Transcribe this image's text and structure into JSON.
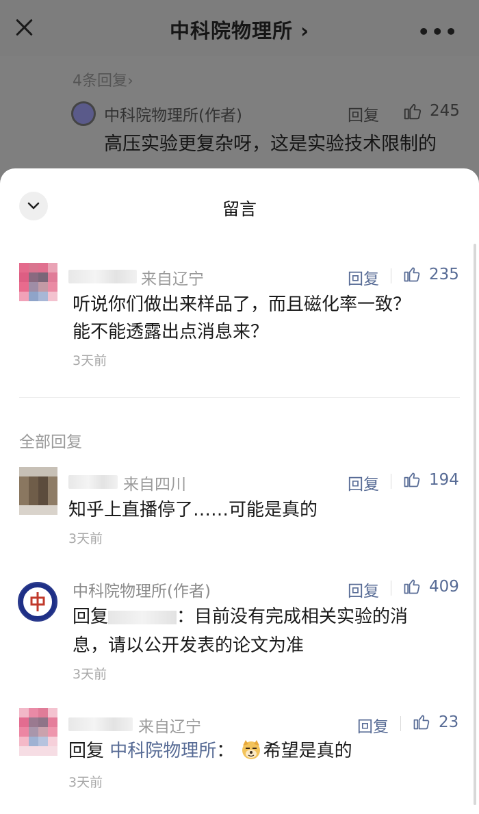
{
  "header": {
    "title": "中科院物理所 ›",
    "more": "•••"
  },
  "background_comment": {
    "replies_link": "4条回复›",
    "author": "中科院物理所(作者)",
    "reply_label": "回复",
    "likes": "245",
    "text": "高压实验更复杂呀，这是实验技术限制的"
  },
  "sheet": {
    "title": "留言",
    "top_comment": {
      "location": "来自辽宁",
      "reply_label": "回复",
      "likes": "235",
      "text_line1": "听说你们做出来样品了，而且磁化率一致？",
      "text_line2": "能不能透露出点消息来？",
      "time": "3天前"
    },
    "section_label": "全部回复",
    "replies": [
      {
        "location": "来自四川",
        "reply_label": "回复",
        "likes": "194",
        "text": "知乎上直播停了……可能是真的",
        "time": "3天前"
      },
      {
        "author": "中科院物理所(作者)",
        "reply_label": "回复",
        "likes": "409",
        "reply_prefix": "回复",
        "text_after_mention": "：目前没有完成相关实验的消",
        "text_line2": "息，请以公开发表的论文为准",
        "time": "3天前"
      },
      {
        "location": "来自辽宁",
        "reply_label": "回复",
        "likes": "23",
        "reply_prefix": "回复",
        "mention": "中科院物理所",
        "colon": "：",
        "text": "希望是真的",
        "time": "3天前"
      }
    ]
  },
  "colors": {
    "link_blue": "#576b95",
    "muted_gray": "#9a9a9a",
    "text_dark": "#1a1a1a"
  },
  "icons": [
    "close-icon",
    "more-icon",
    "chevron-down-icon",
    "thumbs-up-icon",
    "doge-emoji-icon"
  ]
}
